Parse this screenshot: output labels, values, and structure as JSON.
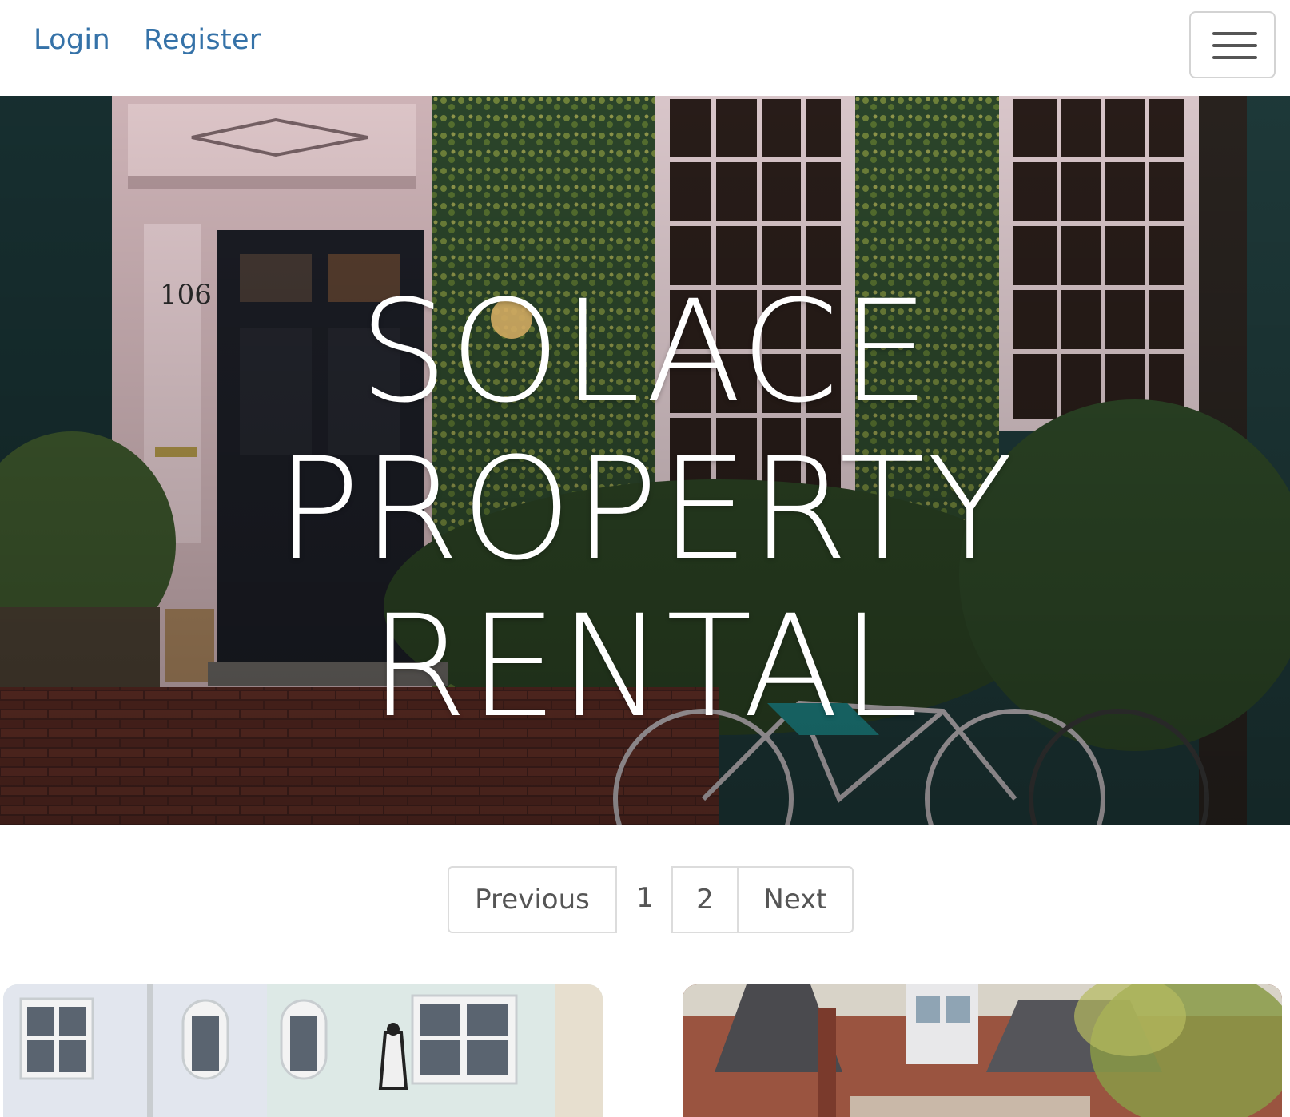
{
  "nav": {
    "login_label": "Login",
    "register_label": "Register",
    "menu_icon": "hamburger-icon"
  },
  "hero": {
    "title_lines": [
      "SOLACE",
      "PROPERTY",
      "RENTAL"
    ],
    "door_number": "106"
  },
  "pagination": {
    "previous_label": "Previous",
    "page_1": "1",
    "page_2": "2",
    "next_label": "Next"
  },
  "colors": {
    "link": "#3572a8",
    "hero_text": "#ffffff",
    "pagination_border": "#dcdcdc"
  }
}
